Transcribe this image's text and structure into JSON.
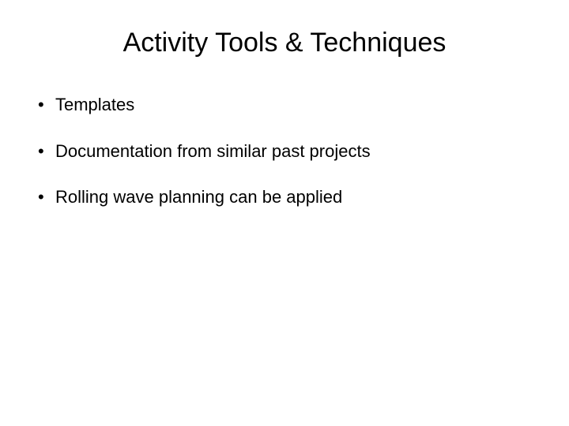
{
  "slide": {
    "title": "Activity Tools & Techniques",
    "bullets": [
      "Templates",
      "Documentation from similar past projects",
      "Rolling wave planning can be applied"
    ]
  }
}
